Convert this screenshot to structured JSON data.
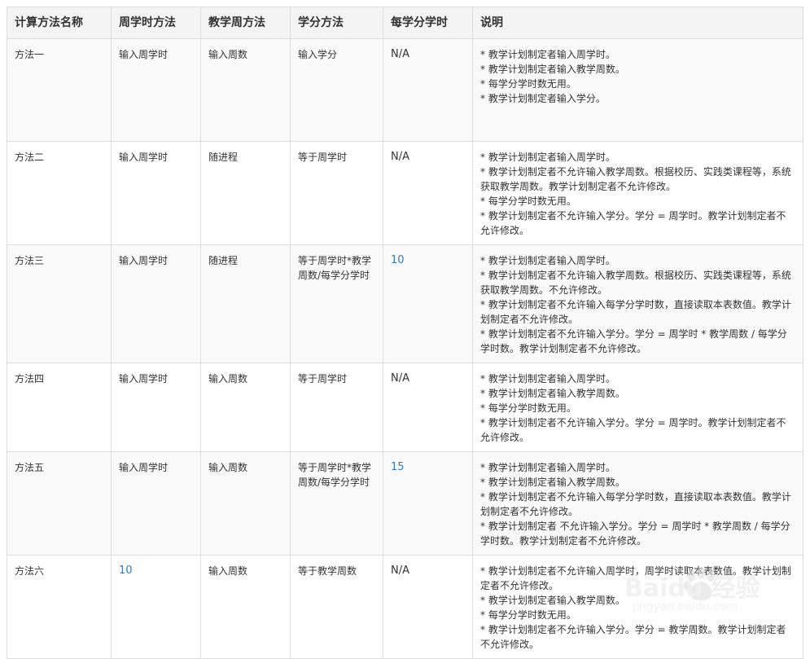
{
  "table": {
    "headers": [
      "计算方法名称",
      "周学时方法",
      "教学周方法",
      "学分方法",
      "每学分学时",
      "说明"
    ],
    "rows": [
      {
        "name": "方法一",
        "weekly_hours": "输入周学时",
        "teaching_weeks": "输入周数",
        "credit": "输入学分",
        "hours_per_credit": "N/A",
        "desc": [
          "* 教学计划制定者输入周学时。",
          "* 教学计划制定者输入教学周数。",
          "* 每学分学时数无用。",
          "* 教学计划制定者输入学分。"
        ]
      },
      {
        "name": "方法二",
        "weekly_hours": "输入周学时",
        "teaching_weeks": "随进程",
        "credit": "等于周学时",
        "hours_per_credit": "N/A",
        "desc": [
          "* 教学计划制定者输入周学时。",
          "* 教学计划制定者不允许输入教学周数。根据校历、实践类课程等，系统获取教学周数。教学计划制定者不允许修改。",
          "* 每学分学时数无用。",
          "* 教学计划制定者不允许输入学分。学分 = 周学时。教学计划制定者不允许修改。"
        ]
      },
      {
        "name": "方法三",
        "weekly_hours": "输入周学时",
        "teaching_weeks": "随进程",
        "credit": "等于周学时*教学周数/每学分学时",
        "hours_per_credit": "10",
        "desc": [
          "* 教学计划制定者输入周学时。",
          "* 教学计划制定者不允许输入教学周数。根据校历、实践类课程等，系统获取教学周数。不允许修改。",
          "* 教学计划制定者不允许输入每学分学时数，直接读取本表数值。教学计划制定者不允许修改。",
          "* 教学计划制定者不允许输入学分。学分 = 周学时 * 教学周数 / 每学分学时数。教学计划制定者不允许修改。"
        ]
      },
      {
        "name": "方法四",
        "weekly_hours": "输入周学时",
        "teaching_weeks": "输入周数",
        "credit": "等于周学时",
        "hours_per_credit": "N/A",
        "desc": [
          "* 教学计划制定者输入周学时。",
          "* 教学计划制定者输入教学周数。",
          "* 每学分学时数无用。",
          "* 教学计划制定者不允许输入学分。学分 = 周学时。教学计划制定者不允许修改。"
        ]
      },
      {
        "name": "方法五",
        "weekly_hours": "输入周学时",
        "teaching_weeks": "输入周数",
        "credit": "等于周学时*教学周数/每学分学时",
        "hours_per_credit": "15",
        "desc": [
          "* 教学计划制定者输入周学时。",
          "* 教学计划制定者输入教学周数。",
          "* 教学计划制定者不允许输入每学分学时数，直接读取本表数值。教学计划制定者不允许修改。",
          "* 教学计划制定者 不允许输入学分。学分 = 周学时 * 教学周数 / 每学分学时数。教学计划制定者不允许修改。"
        ]
      },
      {
        "name": "方法六",
        "weekly_hours": "10",
        "teaching_weeks": "输入周数",
        "credit": "等于教学周数",
        "hours_per_credit": "N/A",
        "desc": [
          "* 教学计划制定者不允许输入周学时，周学时读取本表数值。教学计划制定者不允许修改。",
          "* 教学计划制定者输入教学周数。",
          "* 每学分学时数无用。",
          "* 教学计划制定者不允许输入学分。学分 = 教学周数。教学计划制定者不允许修改。"
        ]
      }
    ]
  },
  "watermark": {
    "brand": "Baidu 经验",
    "url": "jingyan.baidu.com"
  }
}
